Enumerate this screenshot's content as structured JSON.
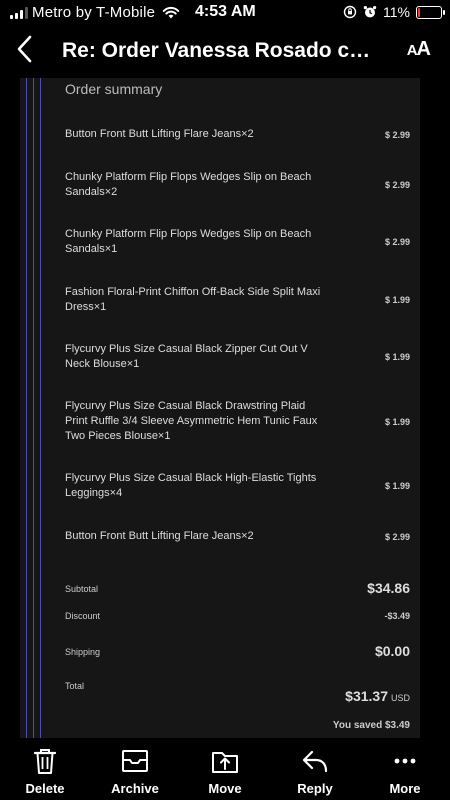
{
  "status_bar": {
    "carrier": "Metro by T-Mobile",
    "time": "4:53 AM",
    "battery_percent": "11%",
    "battery_level": 0.11,
    "signal_bars_filled": 3,
    "signal_bars_total": 4
  },
  "header": {
    "subject": "Re: Order Vanessa Rosado con...",
    "text_size_label_small": "A",
    "text_size_label_large": "A"
  },
  "order": {
    "title": "Order summary",
    "items": [
      {
        "name": "Button Front Butt Lifting Flare Jeans×2",
        "price": "$ 2.99"
      },
      {
        "name": "Chunky Platform Flip Flops Wedges Slip on Beach Sandals×2",
        "price": "$ 2.99"
      },
      {
        "name": "Chunky Platform Flip Flops Wedges Slip on Beach Sandals×1",
        "price": "$ 2.99"
      },
      {
        "name": "Fashion Floral-Print Chiffon Off-Back Side Split Maxi Dress×1",
        "price": "$ 1.99"
      },
      {
        "name": "Flycurvy Plus Size Casual Black Zipper Cut Out V Neck Blouse×1",
        "price": "$ 1.99"
      },
      {
        "name": "Flycurvy Plus Size Casual Black Drawstring Plaid Print Ruffle 3/4 Sleeve Asymmetric Hem Tunic Faux Two Pieces Blouse×1",
        "price": "$ 1.99"
      },
      {
        "name": "Flycurvy Plus Size Casual Black High-Elastic Tights Leggings×4",
        "price": "$ 1.99"
      },
      {
        "name": "Button Front Butt Lifting Flare Jeans×2",
        "price": "$ 2.99"
      }
    ],
    "subtotal_label": "Subtotal",
    "subtotal_value": "$34.86",
    "discount_label": "Discount",
    "discount_value": "-$3.49",
    "shipping_label": "Shipping",
    "shipping_value": "$0.00",
    "total_label": "Total",
    "total_value": "$31.37",
    "total_currency": "USD",
    "saved_text": "You saved $3.49"
  },
  "toolbar": {
    "delete_label": "Delete",
    "archive_label": "Archive",
    "move_label": "Move",
    "reply_label": "Reply",
    "more_label": "More"
  },
  "colors": {
    "background": "#000000",
    "email_body": "#161616",
    "quote_bar": "#4d4db8",
    "battery_low": "#ff3b30"
  }
}
